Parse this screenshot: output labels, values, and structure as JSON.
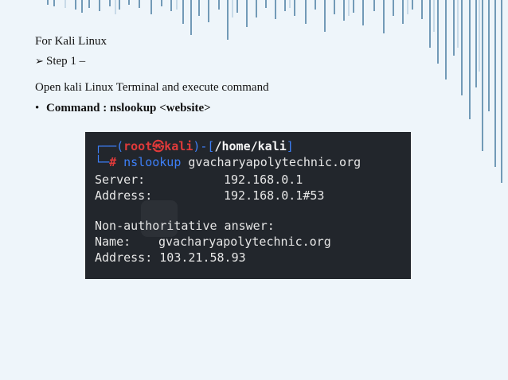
{
  "slide": {
    "line1": "For Kali Linux",
    "line2_marker": "➢",
    "line2": "Step 1 –",
    "line3": "Open kali Linux Terminal and execute command",
    "line4_bullet": "•",
    "line4": "Command : nslookup <website>"
  },
  "terminal": {
    "prompt_open": "┌──(",
    "user": "root㉿kali",
    "prompt_mid": ")-[",
    "path": "/home/kali",
    "prompt_close": "]",
    "prompt2_prefix": "└─",
    "hash": "#",
    "command": "nslookup",
    "argument": "gvacharyapolytechnic.org",
    "server_label": "Server:",
    "server_value": "192.168.0.1",
    "address_label": "Address:",
    "address_value": "192.168.0.1#53",
    "nonauth": "Non-authoritative answer:",
    "name_label": "Name:",
    "name_value": "gvacharyapolytechnic.org",
    "address2_label": "Address:",
    "address2_value": "103.21.58.93"
  },
  "colors": {
    "background": "#eef5fa",
    "terminal_bg": "#22262c",
    "prompt_blue": "#3d7ff7",
    "user_red": "#e03a3a",
    "accent_decor": "#1f5d8a"
  }
}
